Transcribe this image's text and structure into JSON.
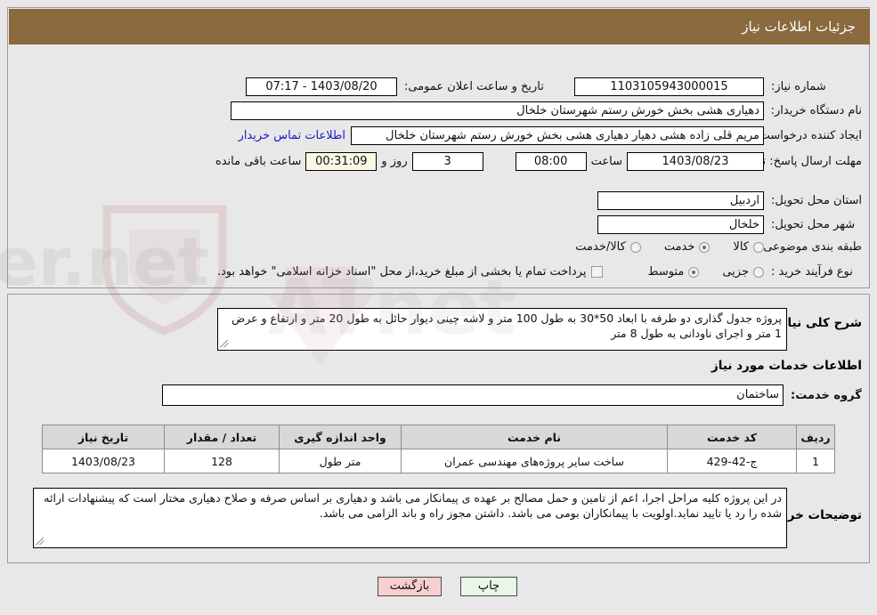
{
  "header": {
    "title": "جزئیات اطلاعات نیاز"
  },
  "form": {
    "need_number_label": "شماره نیاز:",
    "need_number_value": "1103105943000015",
    "public_announce_label": "تاریخ و ساعت اعلان عمومی:",
    "public_announce_value": "1403/08/20 - 07:17",
    "buyer_org_label": "نام دستگاه خریدار:",
    "buyer_org_value": "دهیاری هشی بخش خورش رستم شهرستان خلخال",
    "requester_label": "ایجاد کننده درخواست:",
    "requester_value": "مریم قلی زاده هشی دهیار دهیاری هشی بخش خورش رستم شهرستان خلخال",
    "buyer_contact_link": "اطلاعات تماس خریدار",
    "deadline_label": "مهلت ارسال پاسخ: تا تاریخ:",
    "deadline_date": "1403/08/23",
    "hour_label": "ساعت",
    "hour_value": "08:00",
    "days_value": "3",
    "days_label": "روز و",
    "timer_value": "00:31:09",
    "timer_label": "ساعت باقی مانده",
    "province_label": "استان محل تحویل:",
    "province_value": "اردبیل",
    "city_label": "شهر محل تحویل:",
    "city_value": "خلخال",
    "category_label": "طبقه بندی موضوعی:",
    "category_options": [
      {
        "label": "کالا",
        "selected": false
      },
      {
        "label": "خدمت",
        "selected": true
      },
      {
        "label": "کالا/خدمت",
        "selected": false
      }
    ],
    "process_label": "نوع فرآیند خرید :",
    "process_options": [
      {
        "label": "جزیی",
        "selected": false
      },
      {
        "label": "متوسط",
        "selected": true
      }
    ],
    "treasury_checkbox_checked": false,
    "treasury_note": "پرداخت تمام یا بخشی از مبلغ خرید،از محل \"اسناد خزانه اسلامی\" خواهد بود."
  },
  "description": {
    "label": "شرح کلی نیاز:",
    "value": "پروژه جدول گذاری دو طرفه با ابعاد 50*30 به طول 100 متر و لاشه چینی دیوار حائل به طول 20 متر و ارتفاع و عرض 1 متر و اجرای ناودانی به طول 8 متر"
  },
  "services_section": {
    "title": "اطلاعات خدمات مورد نیاز",
    "service_group_label": "گروه خدمت:",
    "service_group_value": "ساختمان"
  },
  "table": {
    "columns": [
      "ردیف",
      "کد خدمت",
      "نام خدمت",
      "واحد اندازه گیری",
      "تعداد / مقدار",
      "تاریخ نیاز"
    ],
    "rows": [
      {
        "row_no": "1",
        "service_code": "ج-42-429",
        "service_name": "ساخت سایر پروژه‌های مهندسی عمران",
        "unit": "متر طول",
        "quantity": "128",
        "need_date": "1403/08/23"
      }
    ]
  },
  "buyer_notes": {
    "label": "توضیحات خریدار:",
    "value": "در این پروژه کلیه مراحل اجرا، اعم از تامین و حمل مصالح بر عهده ی پیمانکار می باشد و دهیاری بر اساس صرفه و صلاح دهیاری مختار است که پیشنهادات ارائه شده را رد یا تایید نماید.اولویت با پیمانکاران بومی می باشد. داشتن مجوز راه و باند الزامی می باشد."
  },
  "footer": {
    "print_label": "چاپ",
    "back_label": "بازگشت"
  },
  "colors": {
    "header_bg": "#8a6a3e",
    "link": "#1a19c9",
    "timer_bg": "#fbf8e3",
    "print_btn_bg": "#e9f7e9",
    "back_btn_bg": "#f8cfcf"
  }
}
